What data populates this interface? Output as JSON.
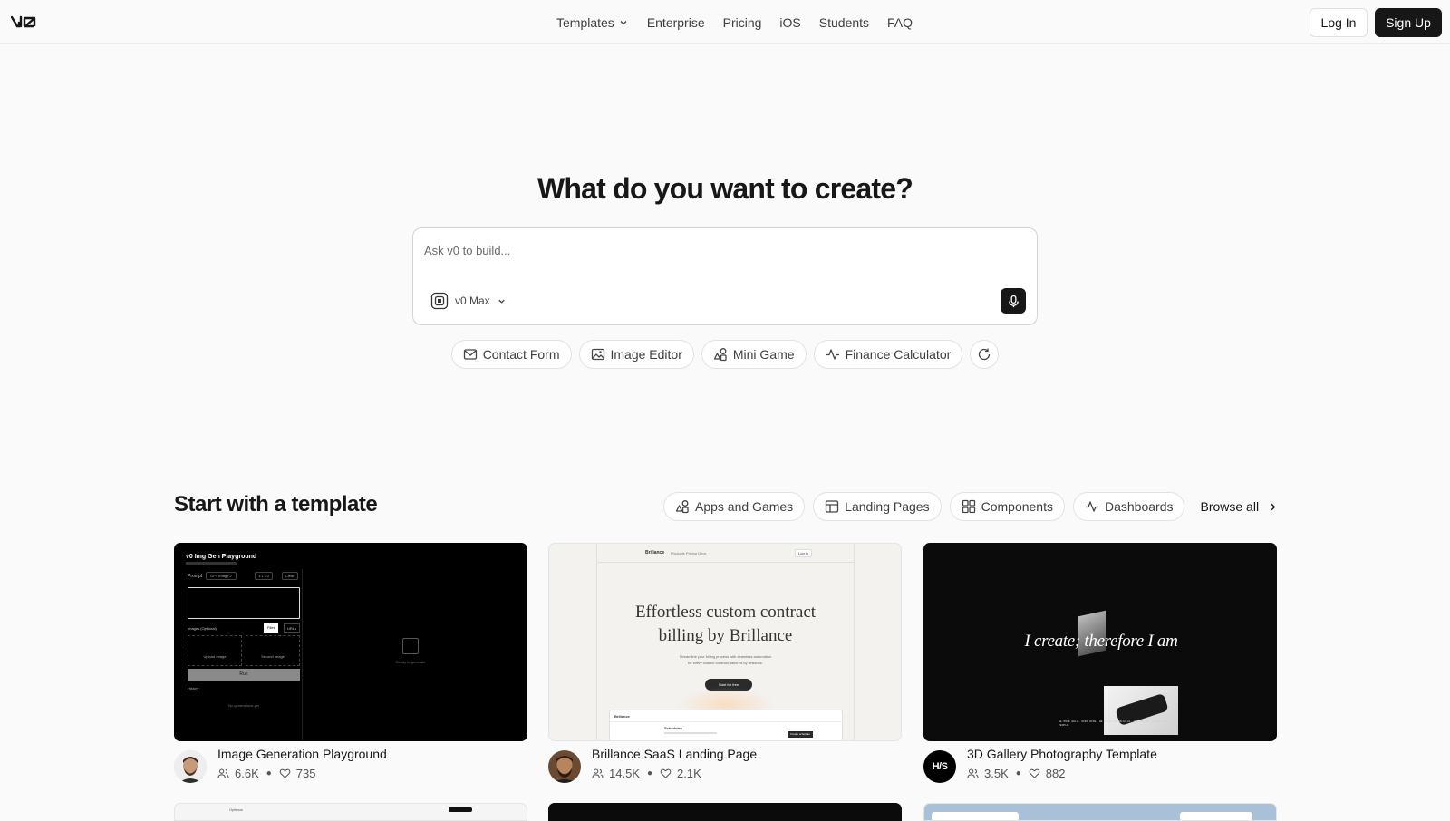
{
  "nav": {
    "items": [
      {
        "label": "Templates",
        "has_dropdown": true
      },
      {
        "label": "Enterprise"
      },
      {
        "label": "Pricing"
      },
      {
        "label": "iOS"
      },
      {
        "label": "Students"
      },
      {
        "label": "FAQ"
      }
    ],
    "login": "Log In",
    "signup": "Sign Up"
  },
  "hero": {
    "title": "What do you want to create?",
    "placeholder": "Ask v0 to build...",
    "model": "v0 Max"
  },
  "suggestions": [
    {
      "label": "Contact Form",
      "icon": "mail-icon"
    },
    {
      "label": "Image Editor",
      "icon": "image-icon"
    },
    {
      "label": "Mini Game",
      "icon": "shapes-icon"
    },
    {
      "label": "Finance Calculator",
      "icon": "activity-icon"
    }
  ],
  "templates": {
    "title": "Start with a template",
    "filters": [
      {
        "label": "Apps and Games",
        "icon": "shapes-icon"
      },
      {
        "label": "Landing Pages",
        "icon": "layout-icon"
      },
      {
        "label": "Components",
        "icon": "grid-icon"
      },
      {
        "label": "Dashboards",
        "icon": "activity-icon"
      }
    ],
    "browse_all": "Browse all",
    "cards": [
      {
        "title": "Image Generation Playground",
        "views": "6.6K",
        "likes": "735",
        "preview": {
          "heading": "v0 Img Gen Playground",
          "prompt_label": "Prompt",
          "model": "GPT Image 2",
          "ratio": "1:1 3:2",
          "clear": "Clear",
          "images_label": "Images (Optional)",
          "files": "Files",
          "urls": "URLs",
          "upload_a": "Upload Image",
          "upload_b": "Second Image",
          "run": "Run",
          "history": "History",
          "no_gen": "No generations yet",
          "ready": "Ready to generate"
        }
      },
      {
        "title": "Brillance SaaS Landing Page",
        "views": "14.5K",
        "likes": "2.1K",
        "preview": {
          "brand": "Brillance",
          "nav_links": "Products  Pricing  Docs",
          "login": "Log in",
          "headline_1": "Effortless custom contract",
          "headline_2": "billing by Brillance",
          "sub_1": "Streamline your billing process with seamless automation",
          "sub_2": "for every custom contract, tailored by Brillance.",
          "cta": "Start for free",
          "panel_title": "Schedules",
          "panel_btn": "Create schedule"
        }
      },
      {
        "title": "3D Gallery Photography Template",
        "views": "3.5K",
        "likes": "882",
        "avatar_text": "H/S",
        "preview": {
          "headline": "I create; therefore I am",
          "caption": "WE MOVE WELL. OPEN WIDE. WE FOCUS ON DETAILS. OUR DESIGN WORKS WITH PEOPLE."
        }
      }
    ]
  },
  "row2": {
    "brand": "Optimus"
  },
  "colors": {
    "primary": "#171717",
    "background": "#fafafa",
    "border": "#e2e2e2"
  }
}
